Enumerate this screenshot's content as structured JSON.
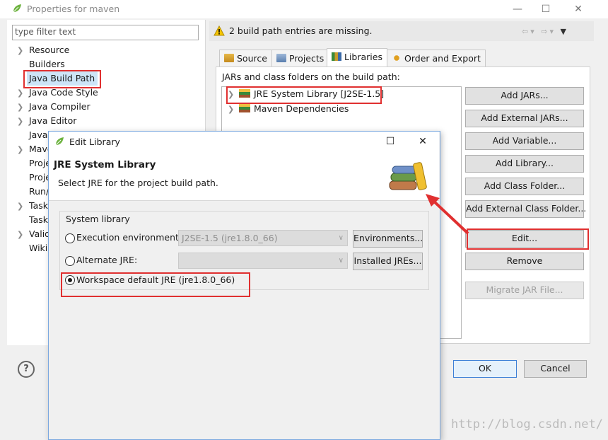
{
  "main_window": {
    "title": "Properties for maven",
    "filter_placeholder": "type filter text",
    "tree_items": [
      {
        "label": "Resource",
        "expandable": true
      },
      {
        "label": "Builders",
        "expandable": false
      },
      {
        "label": "Java Build Path",
        "expandable": false,
        "selected": true
      },
      {
        "label": "Java Code Style",
        "expandable": true
      },
      {
        "label": "Java Compiler",
        "expandable": true
      },
      {
        "label": "Java Editor",
        "expandable": true
      },
      {
        "label": "Javad",
        "expandable": false
      },
      {
        "label": "Mave",
        "expandable": true
      },
      {
        "label": "Proje",
        "expandable": false
      },
      {
        "label": "Proje",
        "expandable": false
      },
      {
        "label": "Run/",
        "expandable": false
      },
      {
        "label": "Task",
        "expandable": true
      },
      {
        "label": "Task",
        "expandable": false
      },
      {
        "label": "Valid",
        "expandable": true
      },
      {
        "label": "Wiki",
        "expandable": false
      }
    ],
    "message": "2 build path entries are missing.",
    "tabs": [
      {
        "label": "Source",
        "icon": "source-icon"
      },
      {
        "label": "Projects",
        "icon": "projects-icon"
      },
      {
        "label": "Libraries",
        "icon": "libraries-icon",
        "active": true
      },
      {
        "label": "Order and Export",
        "icon": "order-export-icon"
      }
    ],
    "jar_label": "JARs and class folders on the build path:",
    "libraries": [
      {
        "label": "JRE System Library [J2SE-1.5]",
        "highlighted": true
      },
      {
        "label": "Maven Dependencies"
      }
    ],
    "side_buttons": [
      {
        "label": "Add JARs...",
        "enabled": true
      },
      {
        "label": "Add External JARs...",
        "enabled": true
      },
      {
        "label": "Add Variable...",
        "enabled": true
      },
      {
        "label": "Add Library...",
        "enabled": true
      },
      {
        "label": "Add Class Folder...",
        "enabled": true
      },
      {
        "label": "Add External Class Folder...",
        "enabled": true
      },
      {
        "label": "Edit...",
        "enabled": true,
        "highlighted": true
      },
      {
        "label": "Remove",
        "enabled": true
      },
      {
        "label": "Migrate JAR File...",
        "enabled": false
      }
    ],
    "ok_label": "OK",
    "cancel_label": "Cancel",
    "help_label": "?"
  },
  "dialog": {
    "title": "Edit Library",
    "header_title": "JRE System Library",
    "header_subtitle": "Select JRE for the project build path.",
    "group_label": "System library",
    "options": [
      {
        "label": "Execution environment:",
        "selected": false,
        "value": "J2SE-1.5 (jre1.8.0_66)",
        "button": "Environments..."
      },
      {
        "label": "Alternate JRE:",
        "selected": false,
        "value": "",
        "button": "Installed JREs..."
      },
      {
        "label": "Workspace default JRE (jre1.8.0_66)",
        "selected": true
      }
    ]
  },
  "watermark": "http://blog.csdn.net/",
  "colors": {
    "highlight_box": "#e03030",
    "annotation_arrow": "#e03030",
    "dialog_border": "#7aa8e0"
  }
}
